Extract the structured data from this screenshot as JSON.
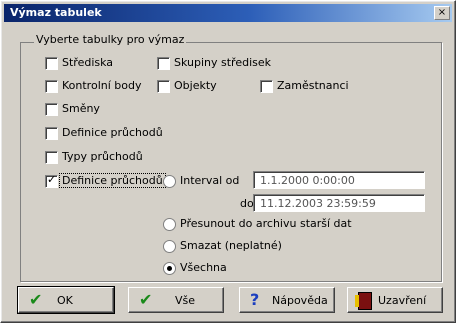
{
  "window": {
    "title": "Výmaz tabulek",
    "close_glyph": "×"
  },
  "group": {
    "title": "Vyberte tabulky pro výmaz"
  },
  "checkboxes": [
    {
      "label": "Střediska",
      "checked": false
    },
    {
      "label": "Skupiny středisek",
      "checked": false
    },
    {
      "label": "Kontrolní body",
      "checked": false
    },
    {
      "label": "Objekty",
      "checked": false
    },
    {
      "label": "Zaměstnanci",
      "checked": false
    },
    {
      "label": "Směny",
      "checked": false
    },
    {
      "label": "Definice průchodů",
      "checked": false
    },
    {
      "label": "Typy průchodů",
      "checked": false
    },
    {
      "label": "Definice průchodů",
      "checked": true
    }
  ],
  "radio_options": [
    {
      "label": "Interval od",
      "selected": false
    },
    {
      "label": "Přesunout do archivu starší dat",
      "selected": false
    },
    {
      "label": "Smazat (neplatné)",
      "selected": false
    },
    {
      "label": "Všechna",
      "selected": true
    }
  ],
  "interval": {
    "from": "1.1.2000 0:00:00",
    "to_label": "do",
    "to": "11.12.2003 23:59:59"
  },
  "buttons": {
    "ok": "OK",
    "all": "Vše",
    "help": "Nápověda",
    "close": "Uzavření"
  },
  "icons": {
    "ok": "check-icon",
    "all": "check-all-icon",
    "help": "help-icon",
    "close": "door-icon"
  }
}
